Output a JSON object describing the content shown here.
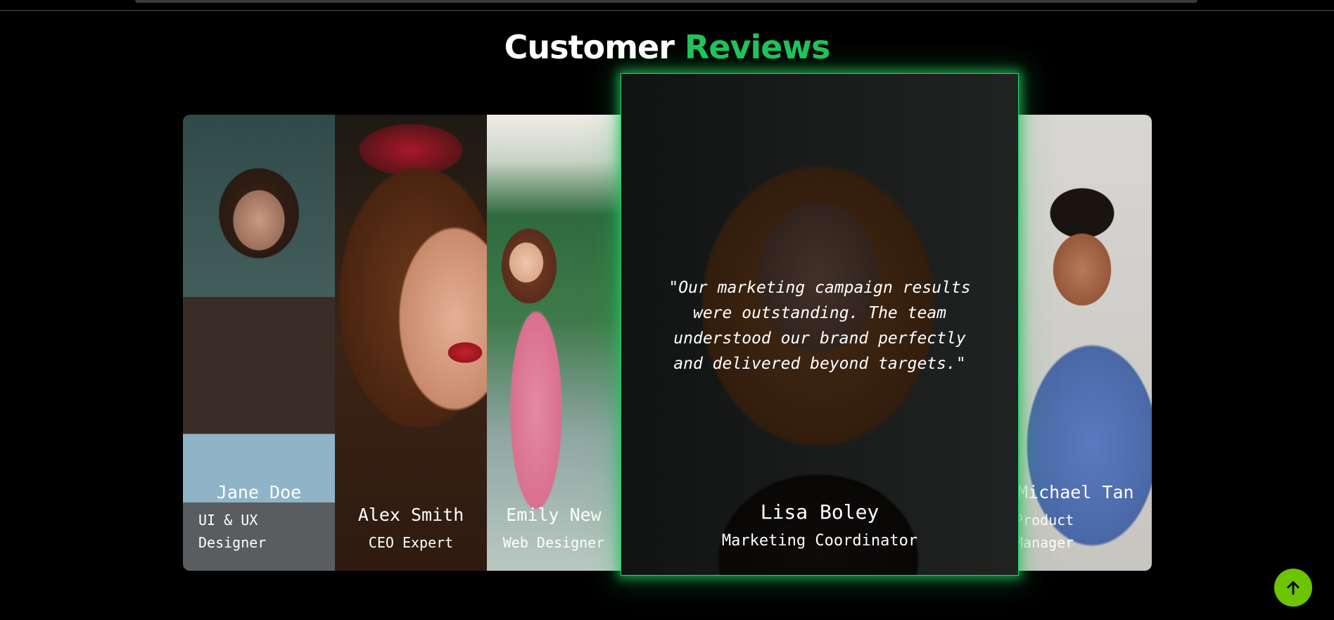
{
  "heading": {
    "part1": "Customer",
    "part2": "Reviews"
  },
  "accent_color": "#1fc45a",
  "button_color": "#6dc400",
  "reviews": [
    {
      "name": "Jane Doe",
      "role": "UI & UX Designer"
    },
    {
      "name": "Alex Smith",
      "role": "CEO Expert"
    },
    {
      "name": "Emily New",
      "role": "Web Designer"
    },
    {
      "name": "Lisa Boley",
      "role": "Marketing Coordinator",
      "quote": "\"Our marketing campaign results were outstanding. The team understood our brand perfectly and delivered beyond targets.\"",
      "active": true
    },
    {
      "name": "Michael Tan",
      "role": "Product Manager"
    }
  ],
  "scroll_top_button": {
    "icon": "arrow-up-icon"
  }
}
